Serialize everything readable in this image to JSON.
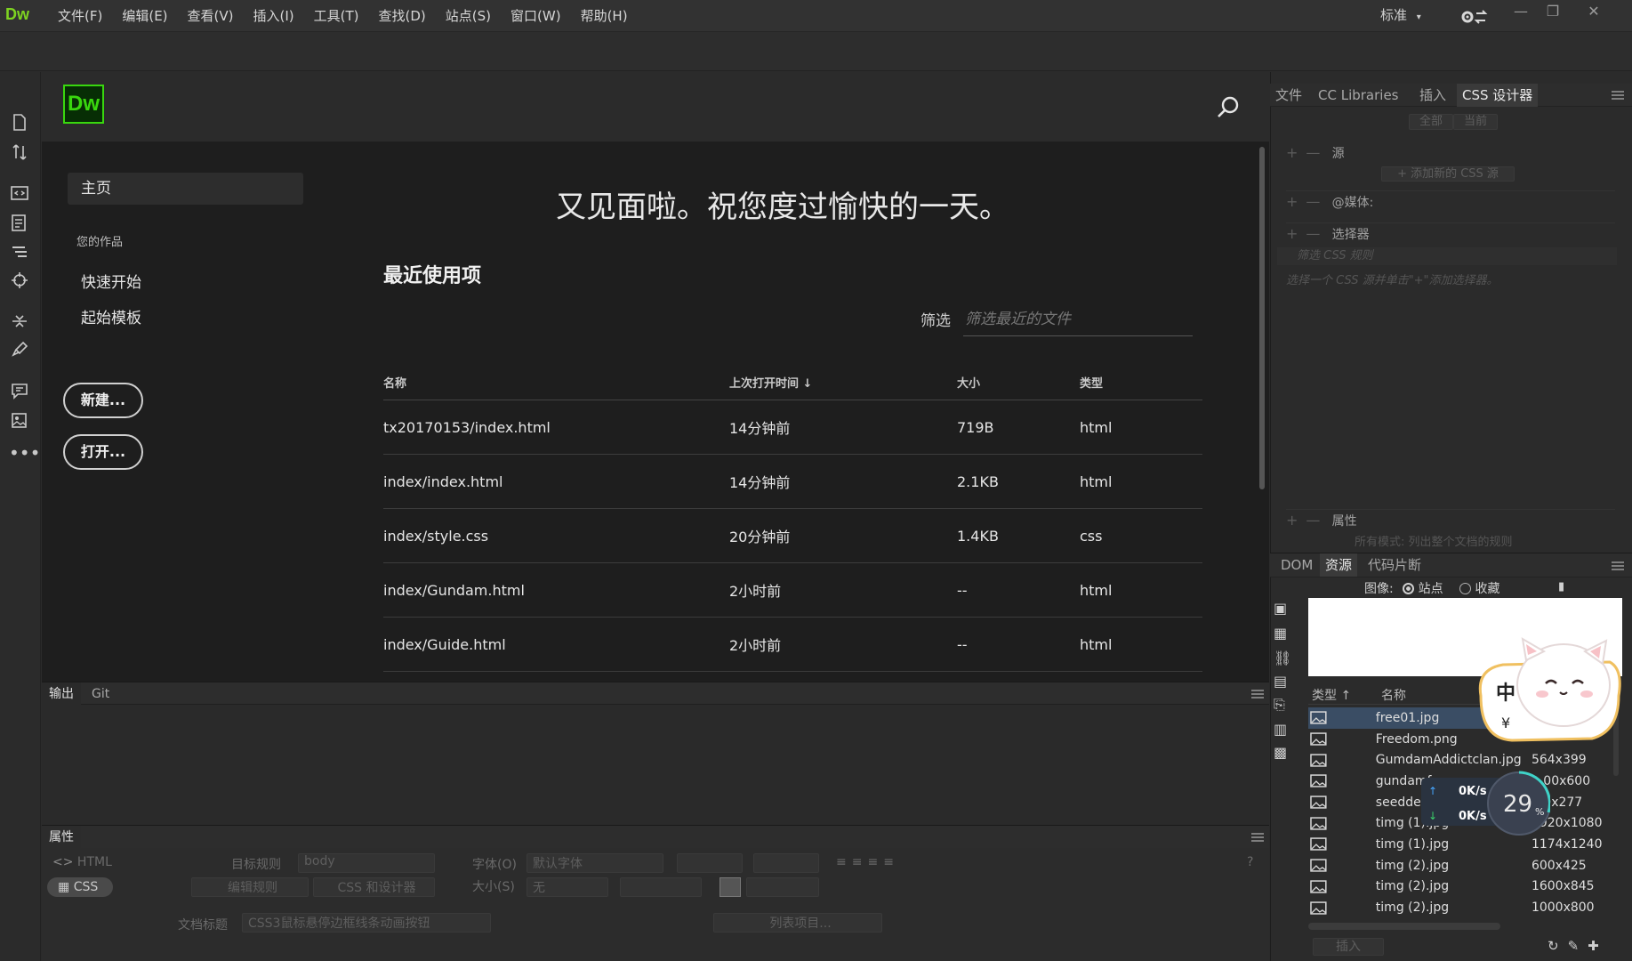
{
  "app": {
    "logo_text": "Dw"
  },
  "menu": [
    "文件(F)",
    "编辑(E)",
    "查看(V)",
    "插入(I)",
    "工具(T)",
    "查找(D)",
    "站点(S)",
    "窗口(W)",
    "帮助(H)"
  ],
  "workspace": {
    "label": "标准"
  },
  "start": {
    "logo_text": "Dw",
    "home_tab": "主页",
    "your_works": "您的作品",
    "quick_start": "快速开始",
    "start_templates": "起始模板",
    "new_button": "新建...",
    "open_button": "打开...",
    "greeting": "又见面啦。祝您度过愉快的一天。",
    "recent_title": "最近使用项",
    "filter_label": "筛选",
    "filter_placeholder": "筛选最近的文件",
    "columns": [
      "名称",
      "上次打开时间 ↓",
      "大小",
      "类型"
    ],
    "rows": [
      [
        "tx20170153/index.html",
        "14分钟前",
        "719B",
        "html"
      ],
      [
        "index/index.html",
        "14分钟前",
        "2.1KB",
        "html"
      ],
      [
        "index/style.css",
        "20分钟前",
        "1.4KB",
        "css"
      ],
      [
        "index/Gundam.html",
        "2小时前",
        "--",
        "html"
      ],
      [
        "index/Guide.html",
        "2小时前",
        "--",
        "html"
      ]
    ]
  },
  "output_panel": {
    "tabs": [
      "输出",
      "Git"
    ]
  },
  "properties_panel": {
    "title": "属性",
    "html_btn": "HTML",
    "css_btn": "CSS",
    "target_rule_label": "目标规则",
    "target_rule_value": "body",
    "edit_rule_btn": "编辑规则",
    "css_designer_btn": "CSS 和设计器",
    "font_label": "字体(O)",
    "font_value": "默认字体",
    "size_label": "大小(S)",
    "size_value": "无",
    "doc_title_label": "文档标题",
    "doc_title_value": "CSS3鼠标悬停边框线条动画按钮",
    "list_items_btn": "列表项目..."
  },
  "right_panel": {
    "tabs": [
      "文件",
      "CC Libraries",
      "插入",
      "CSS 设计器"
    ],
    "all_btn": "全部",
    "current_btn": "当前",
    "source_label": "源",
    "add_source": "+ 添加新的 CSS 源",
    "media_label": "@媒体:",
    "selector_label": "选择器",
    "filter_css_placeholder": "筛选 CSS 规则",
    "selector_hint": "选择一个 CSS 源并单击\"+\"添加选择器。",
    "props_label": "属性",
    "props_hint": "所有模式: 列出整个文档的规则"
  },
  "assets_panel": {
    "tabs": [
      "DOM",
      "资源",
      "代码片断"
    ],
    "image_label": "图像:",
    "site_label": "站点",
    "fav_label": "收藏",
    "col_type": "类型 ↑",
    "col_name": "名称",
    "insert_btn": "插入",
    "items": [
      {
        "name": "free01.jpg",
        "size": ""
      },
      {
        "name": "Freedom.png",
        "size": ""
      },
      {
        "name": "GumdamAddictclan.jpg",
        "size": "564x399"
      },
      {
        "name": "gundamfan...",
        "size": "...00x600"
      },
      {
        "name": "seeddes...",
        "size": "...0x277"
      },
      {
        "name": "timg (1).jpg",
        "size": "1920x1080"
      },
      {
        "name": "timg (1).jpg",
        "size": "1174x1240"
      },
      {
        "name": "timg (2).jpg",
        "size": "600x425"
      },
      {
        "name": "timg (2).jpg",
        "size": "1600x845"
      },
      {
        "name": "timg (2).jpg",
        "size": "1000x800"
      }
    ]
  },
  "overlay": {
    "ime_char": "中",
    "ime_sub": "¥",
    "upload": "0K/s",
    "download": "0K/s",
    "percent": "29",
    "percent_unit": "%"
  }
}
